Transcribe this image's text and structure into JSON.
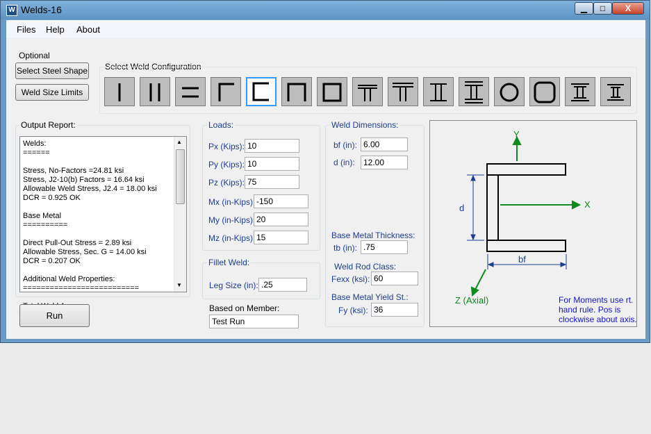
{
  "window": {
    "title": "Welds-16",
    "minimize": "▁",
    "maximize": "□",
    "close": "X"
  },
  "menu": [
    "Files",
    "Help",
    "About"
  ],
  "optional": {
    "label": "Optional",
    "select_shape": "Select Steel Shape",
    "weld_limits": "Weld Size Limits"
  },
  "weld_config": {
    "title": "Select Weld Configuration",
    "selected_index": 4,
    "items": [
      "single-vertical",
      "double-vertical",
      "double-horizontal",
      "angle",
      "channel-left",
      "channel-down",
      "box",
      "tee",
      "double-tee",
      "i-shape",
      "i-boxed",
      "circle",
      "rounded-box",
      "i-flanged",
      "i-small"
    ]
  },
  "output": {
    "title": "Output Report:",
    "lines": [
      "Welds:",
      "======",
      "",
      "Stress, No-Factors =24.81 ksi",
      "Stress, J2-10(b) Factors = 16.64 ksi",
      "Allowable Weld Stress, J2.4 = 18.00 ksi",
      "DCR = 0.925 OK",
      "",
      "Base Metal",
      "==========",
      "",
      "Direct Pull-Out Stress = 2.89 ksi",
      "Allowable Stress, Sec. G = 14.00 ksi",
      "DCR = 0.207 OK",
      "",
      "Additional Weld Properties:",
      "==========================",
      "",
      "Total Weld Area:",
      "---------------"
    ]
  },
  "run_label": "Run",
  "loads": {
    "title": "Loads:",
    "fields": [
      {
        "label": "Px (Kips):",
        "value": "10"
      },
      {
        "label": "Py (Kips):",
        "value": "10"
      },
      {
        "label": "Pz (Kips):",
        "value": "75"
      },
      {
        "label": "Mx (in-Kips):",
        "value": "-150"
      },
      {
        "label": "My (in-Kips):",
        "value": "20"
      },
      {
        "label": "Mz (in-Kips):",
        "value": "15"
      }
    ]
  },
  "fillet": {
    "title": "Fillet Weld:",
    "label": "Leg Size (in):",
    "value": ".25"
  },
  "member": {
    "label": "Based on Member:",
    "value": "Test Run"
  },
  "weld_dims": {
    "title": "Weld Dimensions:",
    "bf_label": "bf (in):",
    "bf_value": "6.00",
    "d_label": "d (in):",
    "d_value": "12.00",
    "thick_title": "Base Metal Thickness:",
    "tb_label": "tb (in):",
    "tb_value": ".75",
    "rod_title": "Weld Rod Class:",
    "fexx_label": "Fexx (ksi):",
    "fexx_value": "60",
    "yield_title": "Base Metal Yield St.:",
    "fy_label": "Fy (ksi):",
    "fy_value": "36"
  },
  "diagram": {
    "y_label": "Y",
    "x_label": "X",
    "z_label": "Z (Axial)",
    "d_label": "d",
    "bf_label": "bf",
    "note": "For Moments use rt. hand rule. Pos is clockwise about axis."
  },
  "colors": {
    "axis_green": "#0f8a1e",
    "dim_blue": "#1d3d8f",
    "note_blue": "#1414c8"
  }
}
